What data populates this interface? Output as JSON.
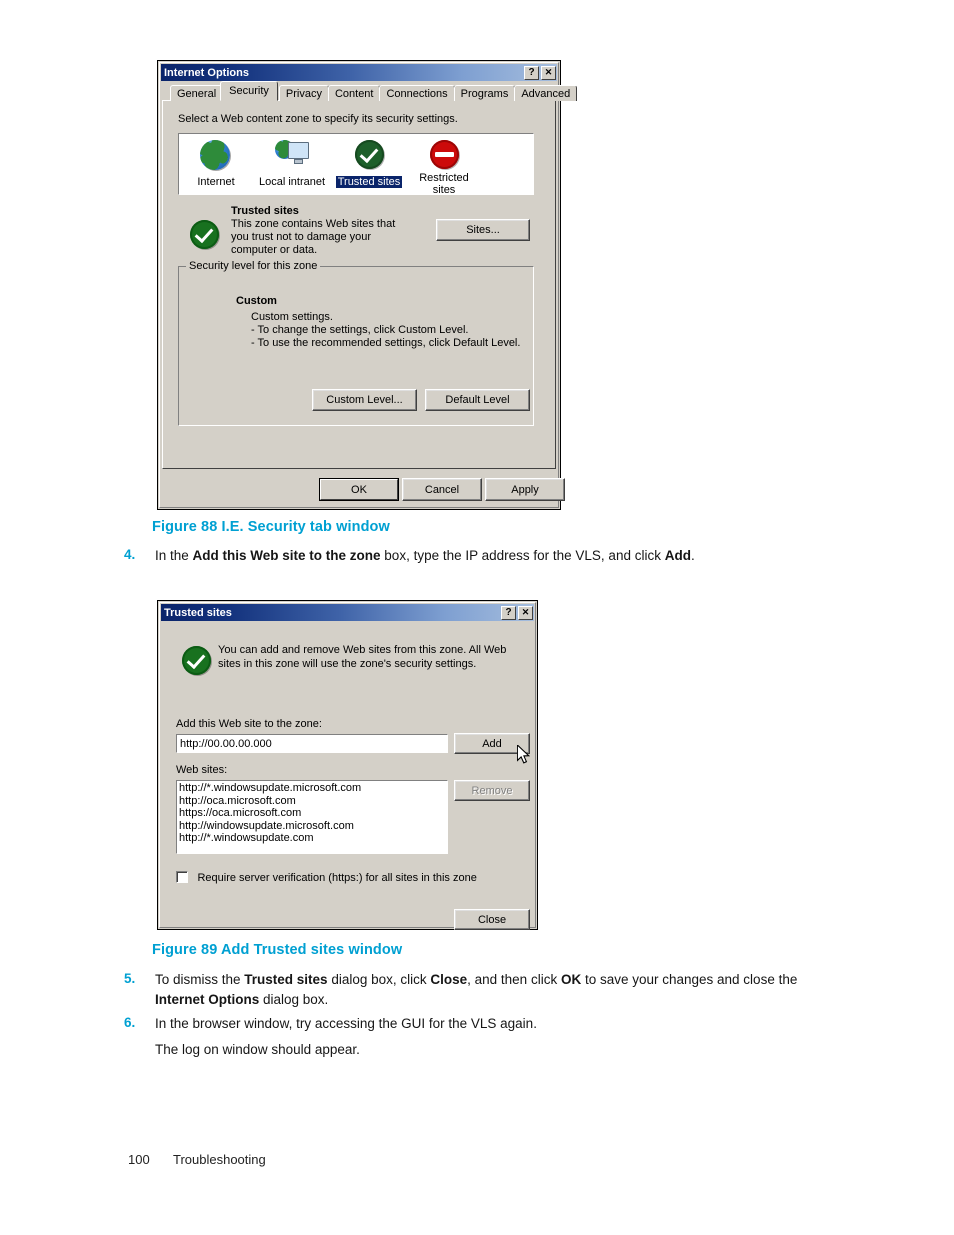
{
  "page": {
    "footer_number": "100",
    "footer_title": "Troubleshooting",
    "accent_color": "#00a0d2"
  },
  "internet_options_dialog": {
    "title": "Internet Options",
    "help_button": "?",
    "close_button": "✕",
    "tabs": [
      {
        "label": "General",
        "active": false
      },
      {
        "label": "Security",
        "active": true
      },
      {
        "label": "Privacy",
        "active": false
      },
      {
        "label": "Content",
        "active": false
      },
      {
        "label": "Connections",
        "active": false
      },
      {
        "label": "Programs",
        "active": false
      },
      {
        "label": "Advanced",
        "active": false
      }
    ],
    "instruction": "Select a Web content zone to specify its security settings.",
    "zones": [
      {
        "label": "Internet",
        "icon": "globe-icon",
        "selected": false
      },
      {
        "label": "Local intranet",
        "icon": "intranet-icon",
        "selected": false
      },
      {
        "label": "Trusted sites",
        "icon": "green-check-icon",
        "selected": true
      },
      {
        "label": "Restricted sites",
        "icon": "restricted-icon",
        "selected": false
      }
    ],
    "zone_detail": {
      "icon": "green-check-icon",
      "heading": "Trusted sites",
      "description": "This zone contains Web sites that you trust not to damage your computer or data.",
      "sites_button": "Sites..."
    },
    "security_level": {
      "group_label": "Security level for this zone",
      "level_name": "Custom",
      "lines": [
        "Custom settings.",
        "- To change the settings, click Custom Level.",
        "- To use the recommended settings, click Default Level."
      ],
      "custom_level_button": "Custom Level...",
      "default_level_button": "Default Level"
    },
    "footer_buttons": {
      "ok": "OK",
      "cancel": "Cancel",
      "apply": "Apply"
    }
  },
  "figure_88": {
    "caption": "Figure 88 I.E. Security tab window"
  },
  "step_4": {
    "number": "4.",
    "part1": "In the ",
    "bold1": "Add this Web site to the zone",
    "part2": " box, type the IP address for the VLS, and click ",
    "bold2": "Add",
    "part3": "."
  },
  "trusted_sites_dialog": {
    "title": "Trusted sites",
    "help_button": "?",
    "close_button": "✕",
    "info_icon": "green-check-icon",
    "info_text": "You can add and remove Web sites from this zone. All Web sites in this zone will use the zone's security settings.",
    "add_label": "Add this Web site to the zone:",
    "add_input_value": "http://00.00.00.000",
    "add_button": "Add",
    "websites_label": "Web sites:",
    "websites": [
      "http://*.windowsupdate.microsoft.com",
      "http://oca.microsoft.com",
      "https://oca.microsoft.com",
      "http://windowsupdate.microsoft.com",
      "http://*.windowsupdate.com"
    ],
    "remove_button": "Remove",
    "remove_disabled": true,
    "require_verification_label": "Require server verification (https:) for all sites in this zone",
    "require_verification_checked": false,
    "close_label": "Close",
    "cursor": "mouse-pointer"
  },
  "figure_89": {
    "caption": "Figure 89 Add Trusted sites window"
  },
  "step_5": {
    "number": "5.",
    "part1": "To dismiss the ",
    "bold1": "Trusted sites",
    "part2": " dialog box, click ",
    "bold2": "Close",
    "part3": ", and then click ",
    "bold3": "OK",
    "part4": " to save your changes and close the ",
    "bold4": "Internet Options",
    "part5": " dialog box."
  },
  "step_6": {
    "number": "6.",
    "text": "In the browser window, try accessing the GUI for the VLS again.",
    "followup": "The log on window should appear."
  }
}
